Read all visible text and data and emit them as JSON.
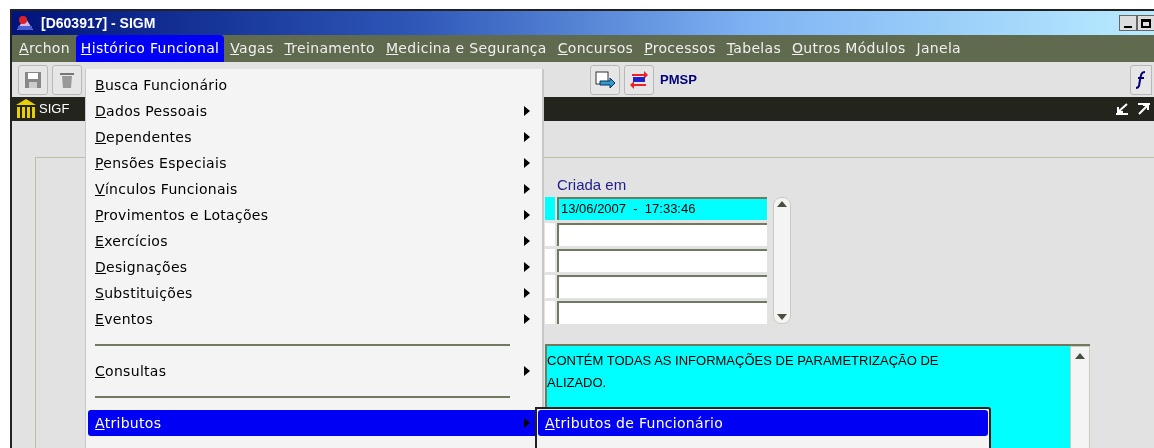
{
  "window": {
    "title": "[D603917] - SIGM"
  },
  "menu_bar": [
    {
      "label": "Archon",
      "mnemonic": true,
      "selected": false
    },
    {
      "label": "Histórico Funcional",
      "mnemonic": true,
      "selected": true
    },
    {
      "label": "Vagas",
      "mnemonic": true,
      "selected": false
    },
    {
      "label": "Treinamento",
      "mnemonic": true,
      "selected": false
    },
    {
      "label": "Medicina e Segurança",
      "mnemonic": true,
      "selected": false
    },
    {
      "label": "Concursos",
      "mnemonic": true,
      "selected": false
    },
    {
      "label": "Processos",
      "mnemonic": true,
      "selected": false
    },
    {
      "label": "Tabelas",
      "mnemonic": true,
      "selected": false
    },
    {
      "label": "Outros Módulos",
      "mnemonic": true,
      "selected": false
    },
    {
      "label": "Janela",
      "mnemonic": false,
      "selected": false
    }
  ],
  "toolbar": {
    "label": "PMSP"
  },
  "inner_window": {
    "title": "SIGF"
  },
  "form": {
    "column_label": "Criada em",
    "rows": [
      {
        "value": "13/06/2007  -  17:33:46",
        "selected": true
      },
      {
        "selected": false
      },
      {
        "selected": false
      },
      {
        "selected": false
      },
      {
        "selected": false
      }
    ]
  },
  "description": {
    "lines": [
      "CONTÉM TODAS AS INFORMAÇÕES DE PARAMETRIZAÇÃO DE",
      "ALIZADO."
    ]
  },
  "dropdown": {
    "items": [
      {
        "kind": "item",
        "label": "Busca Funcionário",
        "submenu": false,
        "selected": false
      },
      {
        "kind": "item",
        "label": "Dados Pessoais",
        "submenu": true,
        "selected": false
      },
      {
        "kind": "item",
        "label": "Dependentes",
        "submenu": true,
        "selected": false
      },
      {
        "kind": "item",
        "label": "Pensões Especiais",
        "submenu": true,
        "selected": false
      },
      {
        "kind": "item",
        "label": "Vínculos Funcionais",
        "submenu": true,
        "selected": false
      },
      {
        "kind": "item",
        "label": "Provimentos e Lotações",
        "submenu": true,
        "selected": false
      },
      {
        "kind": "item",
        "label": "Exercícios",
        "submenu": true,
        "selected": false
      },
      {
        "kind": "item",
        "label": "Designações",
        "submenu": true,
        "selected": false
      },
      {
        "kind": "item",
        "label": "Substituições",
        "submenu": true,
        "selected": false
      },
      {
        "kind": "item",
        "label": "Eventos",
        "submenu": true,
        "selected": false
      },
      {
        "kind": "separator"
      },
      {
        "kind": "item",
        "label": "Consultas",
        "submenu": true,
        "selected": false
      },
      {
        "kind": "separator"
      },
      {
        "kind": "item",
        "label": "Atributos",
        "submenu": true,
        "selected": true
      }
    ]
  },
  "submenu": {
    "items": [
      {
        "label": "Atributos de Funcionário",
        "selected": true
      }
    ]
  }
}
